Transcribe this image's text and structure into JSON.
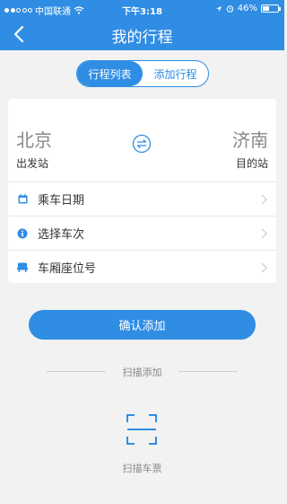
{
  "status_bar": {
    "carrier": "中国联通",
    "time": "下午3:18",
    "battery": "46%",
    "battery_level": 0.46
  },
  "nav": {
    "title": "我的行程"
  },
  "segments": {
    "list": "行程列表",
    "add": "添加行程"
  },
  "route": {
    "from_city": "北京",
    "from_label": "出发站",
    "to_city": "济南",
    "to_label": "目的站"
  },
  "rows": [
    {
      "label": "乘车日期"
    },
    {
      "label": "选择车次"
    },
    {
      "label": "车厢座位号"
    }
  ],
  "confirm_label": "确认添加",
  "scan": {
    "divider": "扫描添加",
    "label": "扫描车票"
  },
  "colors": {
    "primary": "#2f8de4",
    "background": "#f2f2f2"
  }
}
